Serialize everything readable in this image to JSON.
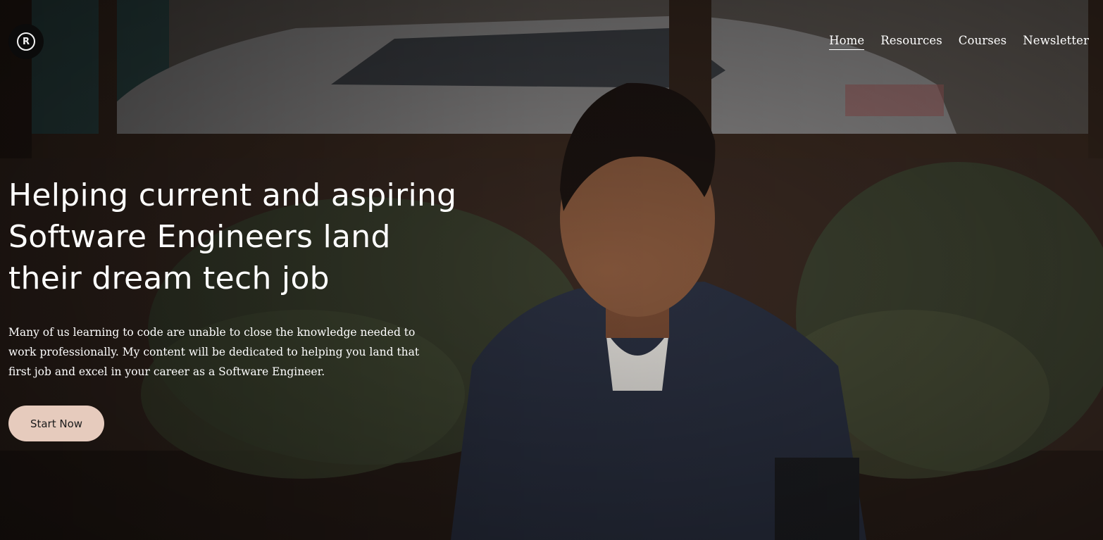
{
  "brand": {
    "logo_icon": "circle-r-logo-icon",
    "logo_glyph": "R"
  },
  "nav": {
    "items": [
      {
        "label": "Home",
        "active": true
      },
      {
        "label": "Resources",
        "active": false
      },
      {
        "label": "Courses",
        "active": false
      },
      {
        "label": "Newsletter",
        "active": false
      }
    ]
  },
  "hero": {
    "headline_lines": [
      "Helping current and aspiring",
      "Software Engineers land",
      "their dream tech job"
    ],
    "subtext": "Many of us learning to code are unable to close the knowledge needed to work professionally. My content will be dedicated to helping you land that first job and excel in your career as a Software Engineer.",
    "cta_label": "Start Now"
  },
  "colors": {
    "cta_background": "#e6cbbd",
    "text": "#ffffff",
    "logo_background": "#0b0b0b"
  }
}
